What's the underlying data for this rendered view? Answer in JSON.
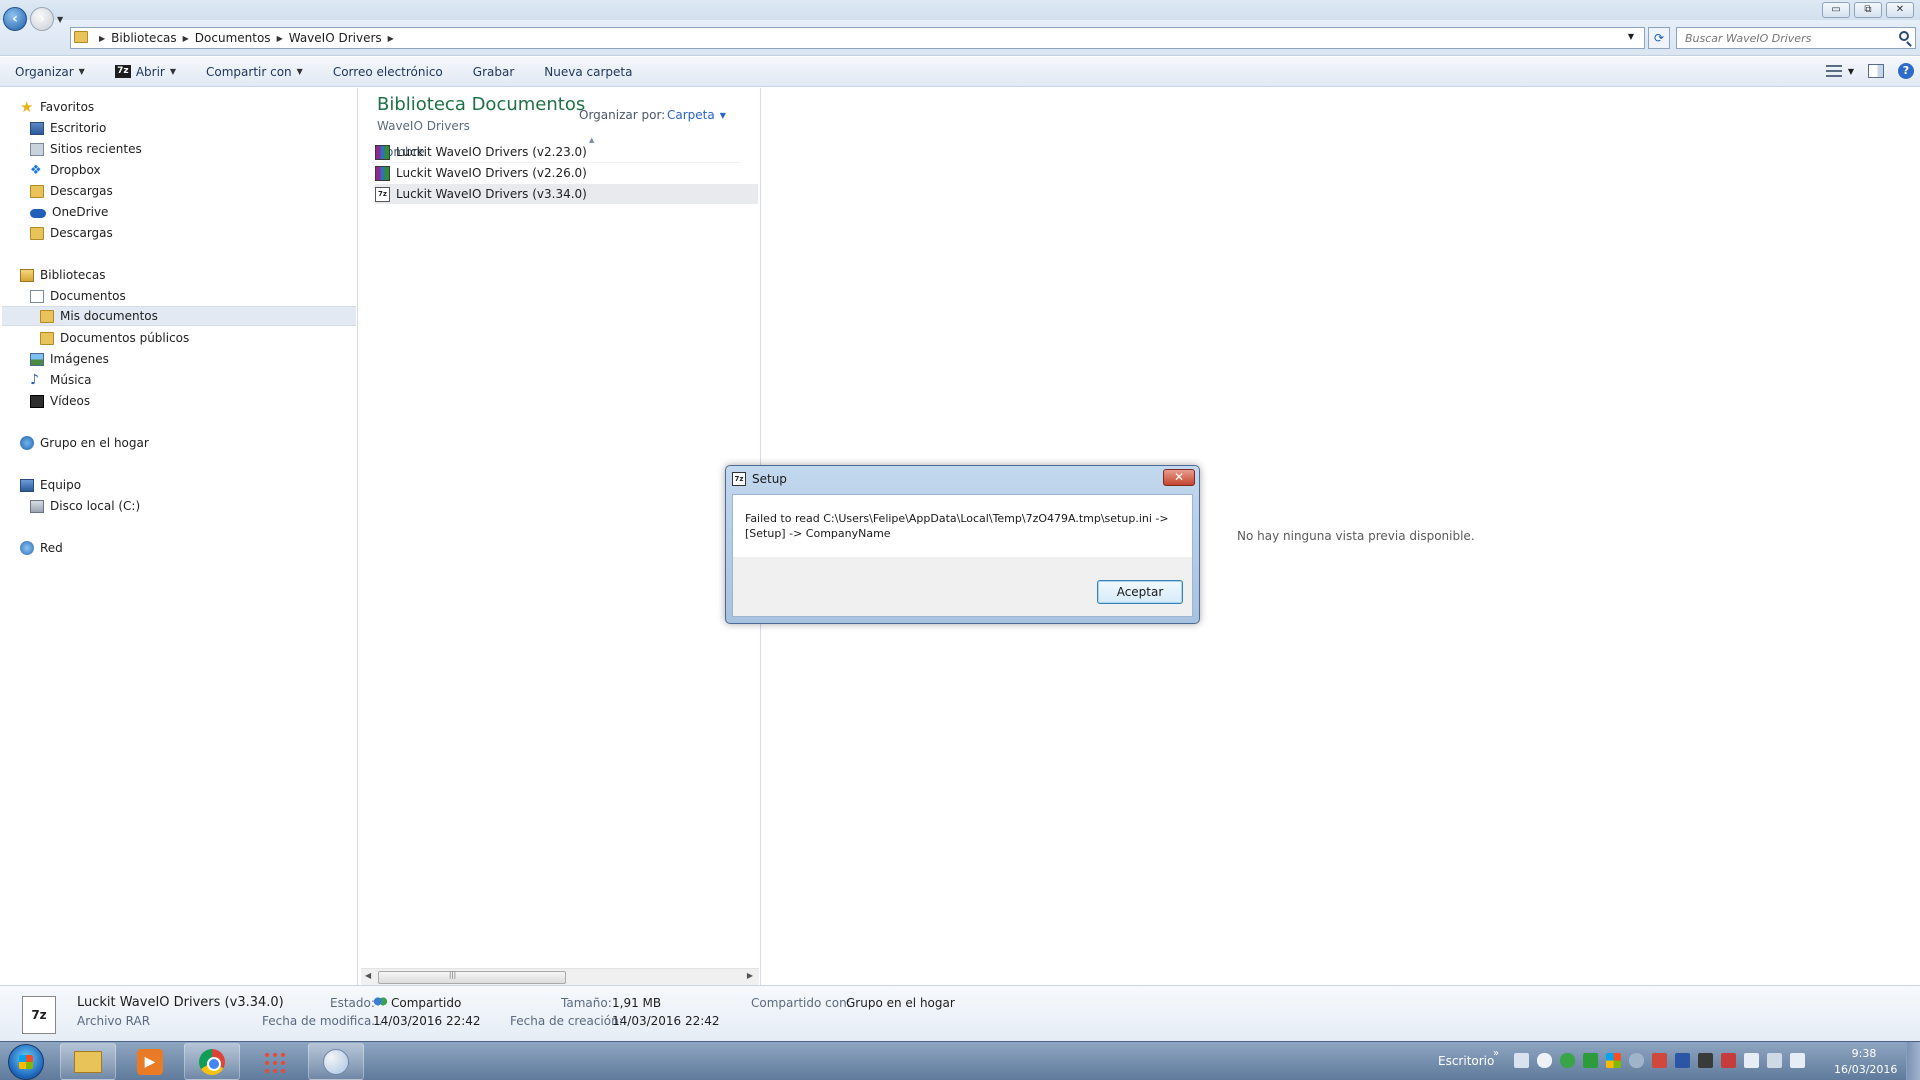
{
  "breadcrumbs": [
    "Bibliotecas",
    "Documentos",
    "WaveIO Drivers"
  ],
  "search": {
    "placeholder": "Buscar WaveIO Drivers"
  },
  "window_buttons": {
    "minimize": "▭",
    "restore": "⧉",
    "close": "✕"
  },
  "toolbar": {
    "organize": "Organizar",
    "open": "Abrir",
    "share": "Compartir con",
    "email": "Correo electrónico",
    "burn": "Grabar",
    "new_folder": "Nueva carpeta"
  },
  "sidebar": {
    "favorites": [
      {
        "label": "Favoritos",
        "icon": "star-icon"
      },
      {
        "label": "Escritorio",
        "icon": "desktop-icon"
      },
      {
        "label": "Sitios recientes",
        "icon": "recent-places-icon"
      },
      {
        "label": "Dropbox",
        "icon": "dropbox-icon"
      },
      {
        "label": "Descargas",
        "icon": "folder-icon"
      },
      {
        "label": "OneDrive",
        "icon": "onedrive-icon"
      },
      {
        "label": "Descargas",
        "icon": "folder-icon"
      }
    ],
    "libraries": [
      {
        "label": "Bibliotecas"
      },
      {
        "label": "Documentos"
      },
      {
        "label": "Mis documentos"
      },
      {
        "label": "Documentos públicos"
      },
      {
        "label": "Imágenes"
      },
      {
        "label": "Música"
      },
      {
        "label": "Vídeos"
      }
    ],
    "homegroup": "Grupo en el hogar",
    "computer": [
      {
        "label": "Equipo"
      },
      {
        "label": "Disco local (C:)"
      }
    ],
    "network": "Red"
  },
  "library": {
    "title": "Biblioteca Documentos",
    "subtitle": "WaveIO Drivers",
    "arrange_label": "Organizar por:",
    "arrange_value": "Carpeta",
    "column_name": "Nombre",
    "files": [
      {
        "name": "Luckit WaveIO Drivers (v2.23.0)",
        "icon": "rar-icon"
      },
      {
        "name": "Luckit WaveIO Drivers (v2.26.0)",
        "icon": "rar-icon"
      },
      {
        "name": "Luckit WaveIO Drivers (v3.34.0)",
        "icon": "7z-icon"
      }
    ]
  },
  "preview": {
    "empty_text": "No hay ninguna vista previa disponible."
  },
  "details": {
    "name": "Luckit WaveIO Drivers (v3.34.0)",
    "type": "Archivo RAR",
    "state_label": "Estado:",
    "state_value": "Compartido",
    "modified_label": "Fecha de modifica...",
    "modified_value": "14/03/2016 22:42",
    "size_label": "Tamaño:",
    "size_value": "1,91 MB",
    "created_label": "Fecha de creación:",
    "created_value": "14/03/2016 22:42",
    "shared_label": "Compartido con:",
    "shared_value": "Grupo en el hogar",
    "icon_text": "7z"
  },
  "dialog": {
    "title": "Setup",
    "message_line1": "Failed to read C:\\Users\\Felipe\\AppData\\Local\\Temp\\7zO479A.tmp\\setup.ini ->",
    "message_line2": "[Setup] -> CompanyName",
    "ok_label": "Aceptar",
    "close_glyph": "✕"
  },
  "taskbar": {
    "desktop_label": "Escritorio",
    "tray_chevron": "»",
    "time": "9:38",
    "date": "16/03/2016"
  },
  "colors": {
    "library_title": "#1e7145",
    "link_blue": "#2a62c9",
    "selection": "#e3e9f2"
  }
}
